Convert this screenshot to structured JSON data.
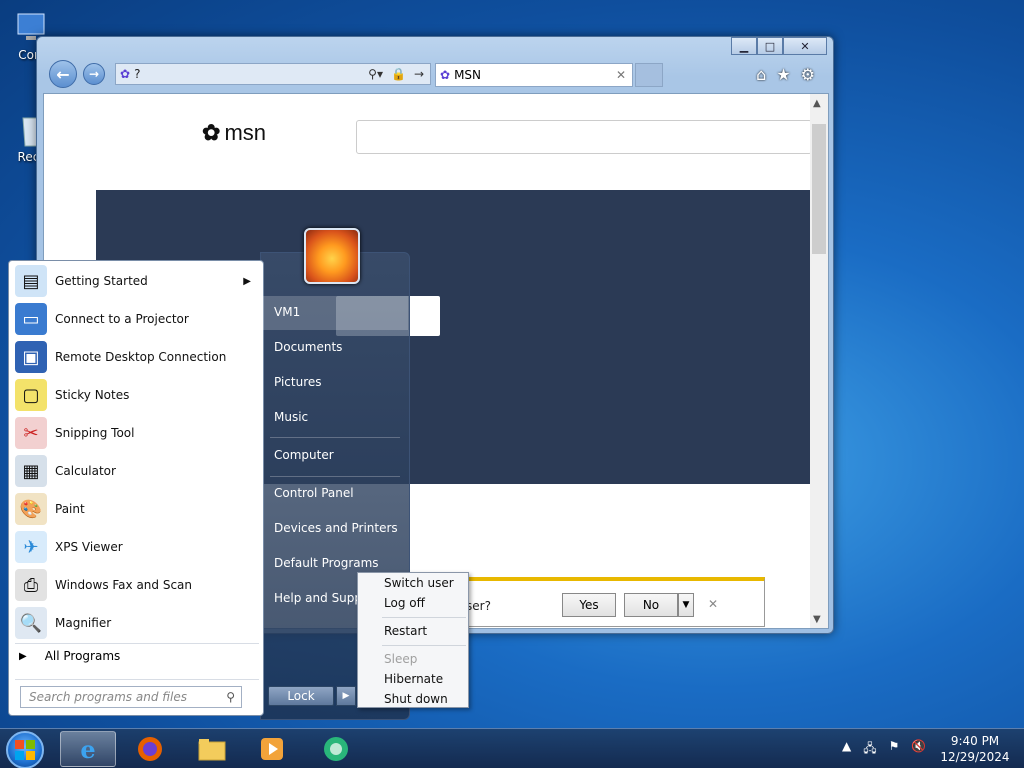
{
  "desktop": {
    "icons": [
      {
        "label": "Com"
      },
      {
        "label": "Recy"
      }
    ]
  },
  "browser": {
    "address": "?",
    "tab_title": "MSN",
    "logo_text": "msn",
    "notification": {
      "text": "ser?",
      "yes_label": "Yes",
      "no_label": "No"
    }
  },
  "start_menu": {
    "programs": [
      {
        "label": "Getting Started",
        "icon": "getting-started-icon",
        "has_arrow": true
      },
      {
        "label": "Connect to a Projector",
        "icon": "projector-icon"
      },
      {
        "label": "Remote Desktop Connection",
        "icon": "remote-desktop-icon"
      },
      {
        "label": "Sticky Notes",
        "icon": "sticky-notes-icon"
      },
      {
        "label": "Snipping Tool",
        "icon": "snipping-tool-icon"
      },
      {
        "label": "Calculator",
        "icon": "calculator-icon"
      },
      {
        "label": "Paint",
        "icon": "paint-icon"
      },
      {
        "label": "XPS Viewer",
        "icon": "xps-viewer-icon"
      },
      {
        "label": "Windows Fax and Scan",
        "icon": "fax-scan-icon"
      },
      {
        "label": "Magnifier",
        "icon": "magnifier-icon"
      }
    ],
    "all_programs": "All Programs",
    "search_placeholder": "Search programs and files",
    "right_items": {
      "user": "VM1",
      "documents": "Documents",
      "pictures": "Pictures",
      "music": "Music",
      "computer": "Computer",
      "control_panel": "Control Panel",
      "devices": "Devices and Printers",
      "default_programs": "Default Programs",
      "help": "Help and Suppo"
    },
    "lock_label": "Lock",
    "power_menu": {
      "switch_user": "Switch user",
      "log_off": "Log off",
      "restart": "Restart",
      "sleep": "Sleep",
      "hibernate": "Hibernate",
      "shut_down": "Shut down"
    }
  },
  "taskbar": {
    "time": "9:40 PM",
    "date": "12/29/2024"
  }
}
